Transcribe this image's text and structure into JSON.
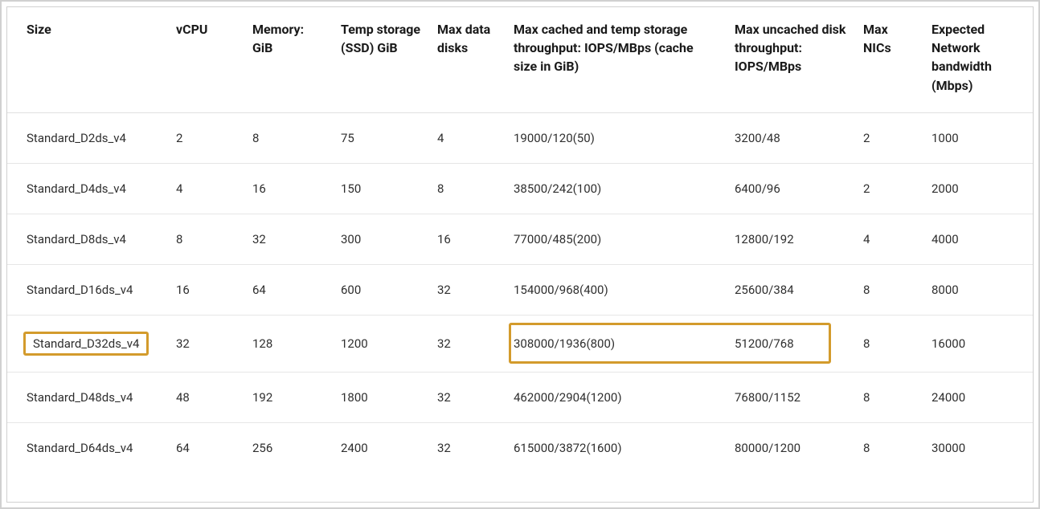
{
  "table": {
    "headers": [
      "Size",
      "vCPU",
      "Memory: GiB",
      "Temp storage (SSD) GiB",
      "Max data disks",
      "Max cached and temp storage throughput: IOPS/MBps (cache size in GiB)",
      "Max uncached disk throughput: IOPS/MBps",
      "Max NICs",
      "Expected Network bandwidth (Mbps)"
    ],
    "rows": [
      {
        "size": "Standard_D2ds_v4",
        "vcpu": "2",
        "memory": "8",
        "temp": "75",
        "mdisks": "4",
        "cached": "19000/120(50)",
        "uncached": "3200/48",
        "nics": "2",
        "bw": "1000",
        "highlight": false
      },
      {
        "size": "Standard_D4ds_v4",
        "vcpu": "4",
        "memory": "16",
        "temp": "150",
        "mdisks": "8",
        "cached": "38500/242(100)",
        "uncached": "6400/96",
        "nics": "2",
        "bw": "2000",
        "highlight": false
      },
      {
        "size": "Standard_D8ds_v4",
        "vcpu": "8",
        "memory": "32",
        "temp": "300",
        "mdisks": "16",
        "cached": "77000/485(200)",
        "uncached": "12800/192",
        "nics": "4",
        "bw": "4000",
        "highlight": false
      },
      {
        "size": "Standard_D16ds_v4",
        "vcpu": "16",
        "memory": "64",
        "temp": "600",
        "mdisks": "32",
        "cached": "154000/968(400)",
        "uncached": "25600/384",
        "nics": "8",
        "bw": "8000",
        "highlight": false
      },
      {
        "size": "Standard_D32ds_v4",
        "vcpu": "32",
        "memory": "128",
        "temp": "1200",
        "mdisks": "32",
        "cached": "308000/1936(800)",
        "uncached": "51200/768",
        "nics": "8",
        "bw": "16000",
        "highlight": true
      },
      {
        "size": "Standard_D48ds_v4",
        "vcpu": "48",
        "memory": "192",
        "temp": "1800",
        "mdisks": "32",
        "cached": "462000/2904(1200)",
        "uncached": "76800/1152",
        "nics": "8",
        "bw": "24000",
        "highlight": false
      },
      {
        "size": "Standard_D64ds_v4",
        "vcpu": "64",
        "memory": "256",
        "temp": "2400",
        "mdisks": "32",
        "cached": "615000/3872(1600)",
        "uncached": "80000/1200",
        "nics": "8",
        "bw": "30000",
        "highlight": false
      }
    ]
  }
}
